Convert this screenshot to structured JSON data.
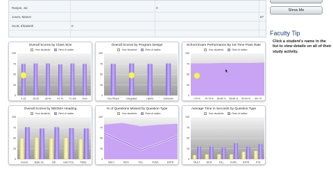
{
  "students": [
    {
      "name": "Ranjan, Jai",
      "score_a": "",
      "score_b": "0",
      "score_c": ""
    },
    {
      "name": "Jones, Maeve",
      "score_a": "",
      "score_b": "",
      "score_c": "87"
    },
    {
      "name": "Scott, Elizabeth",
      "score_a": "0",
      "score_b": "",
      "score_c": ""
    }
  ],
  "show_button_label": "Show Me",
  "tip": {
    "title": "Faculty Tip",
    "text": "Click a student's name in the list to view details on all of their study activity."
  },
  "legend": {
    "you": "Your students",
    "nat": "Rest of nation"
  },
  "colors": {
    "you": "#f1eda4",
    "nat": "#a98cf0",
    "nat_dark": "#7e5fd8",
    "area": "#c9a4f5",
    "accent": "#1a3f8c"
  },
  "chart_data": [
    {
      "type": "bar",
      "title": "Overall Scores by Class Size",
      "ylim": [
        0,
        100
      ],
      "yticks": [
        "0",
        "25",
        "50",
        "75",
        "100"
      ],
      "categories": [
        "0-15",
        "16-25",
        "26-40",
        "41-70",
        "71-100",
        "Over"
      ],
      "series": [
        {
          "name": "Your students",
          "values": [
            0,
            0,
            0,
            0,
            0,
            0
          ]
        },
        {
          "name": "Rest of nation",
          "values": [
            75,
            76,
            76,
            74,
            76,
            75
          ]
        }
      ],
      "marker_value": 48
    },
    {
      "type": "bar",
      "title": "Overall Scores by Program Design",
      "ylim": [
        0,
        100
      ],
      "yticks": [
        "0",
        "25",
        "50",
        "75",
        "100"
      ],
      "categories": [
        "Two-Phase",
        "Integrated",
        "Hybrid",
        "Unknown"
      ],
      "series": [
        {
          "name": "Your students",
          "values": [
            0,
            0,
            0,
            0
          ]
        },
        {
          "name": "Rest of nation",
          "values": [
            75,
            76,
            75,
            76
          ]
        }
      ],
      "marker_value": 48
    },
    {
      "type": "area",
      "title": "School Exam Performance By 1st Time Pass Rate",
      "ylim": [
        0,
        100
      ],
      "yticks": [
        "0",
        "25",
        "50",
        "75",
        "100"
      ],
      "categories": [
        "<70 %",
        "70-79 %",
        "80-84 %",
        "85-89 %",
        "90-94 %",
        "95+ %"
      ],
      "series": [
        {
          "name": "Your students",
          "values": [
            0,
            0,
            0,
            0,
            0,
            0
          ]
        },
        {
          "name": "Rest of nation",
          "values": [
            76,
            76,
            77,
            77,
            77,
            78
          ]
        }
      ],
      "marker_value": 47
    },
    {
      "type": "bar",
      "title": "Overall Scores by NBOMA Heading",
      "ylim": [
        0,
        100
      ],
      "yticks": [
        "0",
        "25",
        "50",
        "75",
        "100"
      ],
      "categories": [
        "Found.",
        "Basic Sc.",
        "Clin.",
        "Hum Proc.",
        "Patho."
      ],
      "series": [
        {
          "name": "Your students",
          "values": [
            50,
            52,
            50,
            51,
            48
          ]
        },
        {
          "name": "Rest of nation",
          "values": [
            76,
            73,
            76,
            74,
            73
          ]
        }
      ]
    },
    {
      "type": "line",
      "title": "% of Questions Missed by Question Type",
      "ylim": [
        0,
        100
      ],
      "yticks": [
        "0",
        "25",
        "50",
        "75",
        "100"
      ],
      "categories": [
        "MULT",
        "MCH",
        "FILL",
        "FUNC",
        "EXPR"
      ],
      "series": [
        {
          "name": "Your students",
          "values": [
            62,
            42,
            22,
            38,
            55
          ]
        },
        {
          "name": "Rest of nation",
          "values": [
            82,
            86,
            78,
            82,
            84
          ]
        }
      ]
    },
    {
      "type": "bar",
      "title": "Average Time in Seconds by Question Type",
      "ylim": [
        0,
        100
      ],
      "yticks": [
        "0",
        "25",
        "50",
        "75",
        "100"
      ],
      "categories": [
        "MULT",
        "MCH",
        "FILL",
        "FUNC",
        "EXPR",
        "PTS"
      ],
      "series": [
        {
          "name": "Your students",
          "values": [
            10,
            12,
            12,
            12,
            18,
            20
          ]
        },
        {
          "name": "Rest of nation",
          "values": [
            30,
            30,
            28,
            38,
            30,
            36
          ]
        }
      ]
    }
  ]
}
